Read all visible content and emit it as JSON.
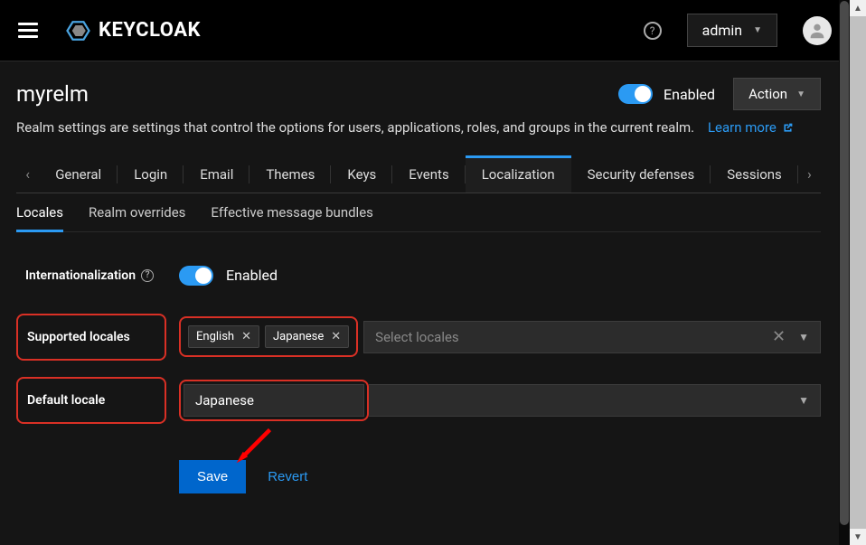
{
  "header": {
    "brand": "KEYCLOAK",
    "help_glyph": "?",
    "user_menu_label": "admin"
  },
  "realm": {
    "title": "myrelm",
    "enabled_label": "Enabled",
    "action_label": "Action",
    "description_prefix": "Realm settings are settings that control the options for users, applications, roles, and groups in the current realm.",
    "learn_more": "Learn more"
  },
  "tabs": {
    "items": [
      "General",
      "Login",
      "Email",
      "Themes",
      "Keys",
      "Events",
      "Localization",
      "Security defenses",
      "Sessions"
    ],
    "active": "Localization"
  },
  "subtabs": {
    "items": [
      "Locales",
      "Realm overrides",
      "Effective message bundles"
    ],
    "active": "Locales"
  },
  "form": {
    "i18n_label": "Internationalization",
    "i18n_enabled_text": "Enabled",
    "supported_label": "Supported locales",
    "supported_chips": [
      "English",
      "Japanese"
    ],
    "select_placeholder": "Select locales",
    "default_label": "Default locale",
    "default_value": "Japanese",
    "save_label": "Save",
    "revert_label": "Revert"
  }
}
